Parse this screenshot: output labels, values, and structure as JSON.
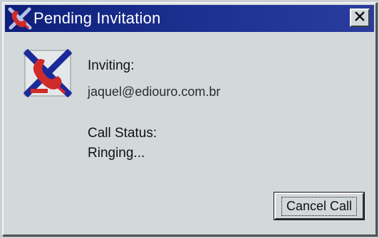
{
  "window": {
    "title": "Pending Invitation",
    "title_icon": "crossed-phone-icon",
    "close_icon": "close-icon"
  },
  "invitation": {
    "app_icon": "phone-handset-icon",
    "inviting_label": "Inviting:",
    "invitee": "jaquel@ediouro.com.br",
    "status_label": "Call Status:",
    "status_value": "Ringing..."
  },
  "actions": {
    "cancel_label": "Cancel Call"
  },
  "colors": {
    "title_bar": "#1d3192",
    "window_bg": "#d3d9db",
    "icon_red": "#d02a2a",
    "icon_blue": "#1a2a9a"
  }
}
